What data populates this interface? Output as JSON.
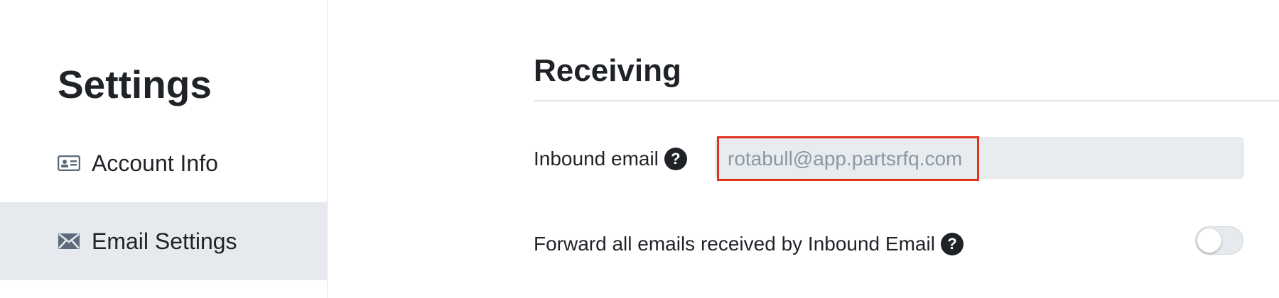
{
  "sidebar": {
    "title": "Settings",
    "items": [
      {
        "label": "Account Info",
        "icon": "id-card-icon"
      },
      {
        "label": "Email Settings",
        "icon": "envelope-icon",
        "active": true
      }
    ]
  },
  "main": {
    "section_title": "Receiving",
    "inbound_email": {
      "label": "Inbound email",
      "help": "?",
      "value": "rotabull@app.partsrfq.com"
    },
    "forward": {
      "label": "Forward all emails received by Inbound Email",
      "help": "?",
      "enabled": false
    }
  },
  "colors": {
    "highlight_border": "#e0321c",
    "active_nav_bg": "#e6eaee",
    "field_bg": "#e8ecef"
  }
}
